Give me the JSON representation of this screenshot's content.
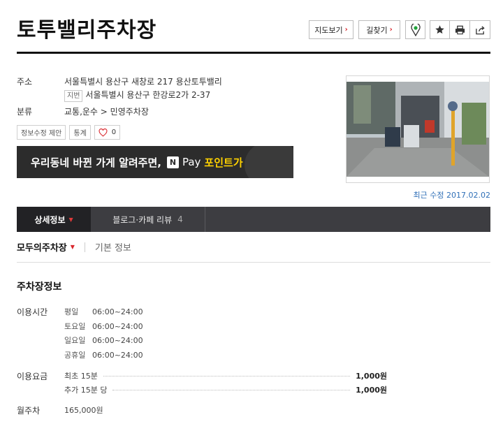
{
  "title": "토투밸리주차장",
  "actions": {
    "map_label": "지도보기",
    "route_label": "길찾기",
    "chevron": "›",
    "icons": [
      "location-pin-icon",
      "star-icon",
      "print-icon",
      "share-icon"
    ]
  },
  "info": {
    "address_label": "주소",
    "address": "서울특별시 용산구 새창로 217 용산토투밸리",
    "jibun_badge": "지번",
    "jibun": "서울특별시 용산구 한강로2가 2-37",
    "category_label": "분류",
    "category": "교통,운수 > 민영주차장"
  },
  "chips": {
    "suggest": "정보수정 제안",
    "stats": "통계",
    "like_count": "0"
  },
  "banner": {
    "text1": "우리동네 바뀐 가게 알려주면,",
    "nlogo": "N",
    "pay": "Pay",
    "text2": "포인트가 펑펑!"
  },
  "updated": "최근 수정 2017.02.02",
  "tabs": {
    "detail": "상세정보",
    "review": "블로그·카페 리뷰",
    "review_count": "4"
  },
  "subtabs": {
    "modu": "모두의주차장",
    "basic": "기본 정보"
  },
  "parking": {
    "section_title": "주차장정보",
    "hours_label": "이용시간",
    "hours": [
      {
        "day": "평일",
        "time": "06:00~24:00"
      },
      {
        "day": "토요일",
        "time": "06:00~24:00"
      },
      {
        "day": "일요일",
        "time": "06:00~24:00"
      },
      {
        "day": "공휴일",
        "time": "06:00~24:00"
      }
    ],
    "fee_label": "이용요금",
    "fees": [
      {
        "label": "최초 15분",
        "price": "1,000원"
      },
      {
        "label": "추가 15분 당",
        "price": "1,000원"
      }
    ],
    "monthly_label": "월주차",
    "monthly": "165,000원"
  },
  "colors": {
    "accent_red": "#d9262c",
    "tab_bg": "#3d3d41",
    "link_blue": "#2f6fb7",
    "banner_yellow": "#ffd200"
  }
}
